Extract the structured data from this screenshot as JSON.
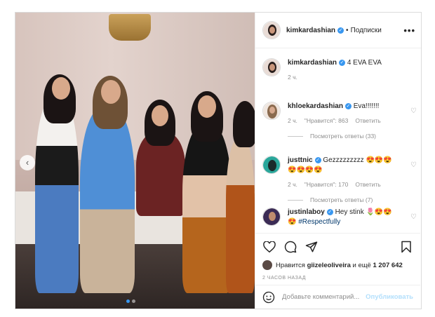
{
  "header": {
    "username": "kimkardashian",
    "dot": "•",
    "follow_label": "Подписки",
    "more_label": "•••"
  },
  "caption": {
    "username": "kimkardashian",
    "text": "4 EVA EVA",
    "time": "2 ч."
  },
  "comments": [
    {
      "username": "khloekardashian",
      "text": "Eva!!!!!!!",
      "time": "2 ч.",
      "likes": "\"Нравится\": 863",
      "reply_label": "Ответить",
      "view_replies": "Посмотреть ответы (33)"
    },
    {
      "username": "justtnic",
      "text": "Gezzzzzzzzz 😍😍😍😍😍😍😍",
      "time": "2 ч.",
      "likes": "\"Нравится\": 170",
      "reply_label": "Ответить",
      "view_replies": "Посмотреть ответы (7)"
    },
    {
      "username": "justinlaboy",
      "text": "Hey stink 🌷😍😍😍",
      "hashtag": "#Respectfully"
    }
  ],
  "likes_line": {
    "prefix": "Нравится",
    "user": "giizeleoliveira",
    "middle": "и ещё",
    "count": "1 207 642"
  },
  "post_time": "2 ЧАСОВ НАЗАД",
  "add_comment": {
    "placeholder": "Добавьте комментарий...",
    "post_label": "Опубликовать"
  },
  "colors": {
    "verified": "#3897f0",
    "link": "#00376b",
    "muted": "#8e8e8e"
  }
}
